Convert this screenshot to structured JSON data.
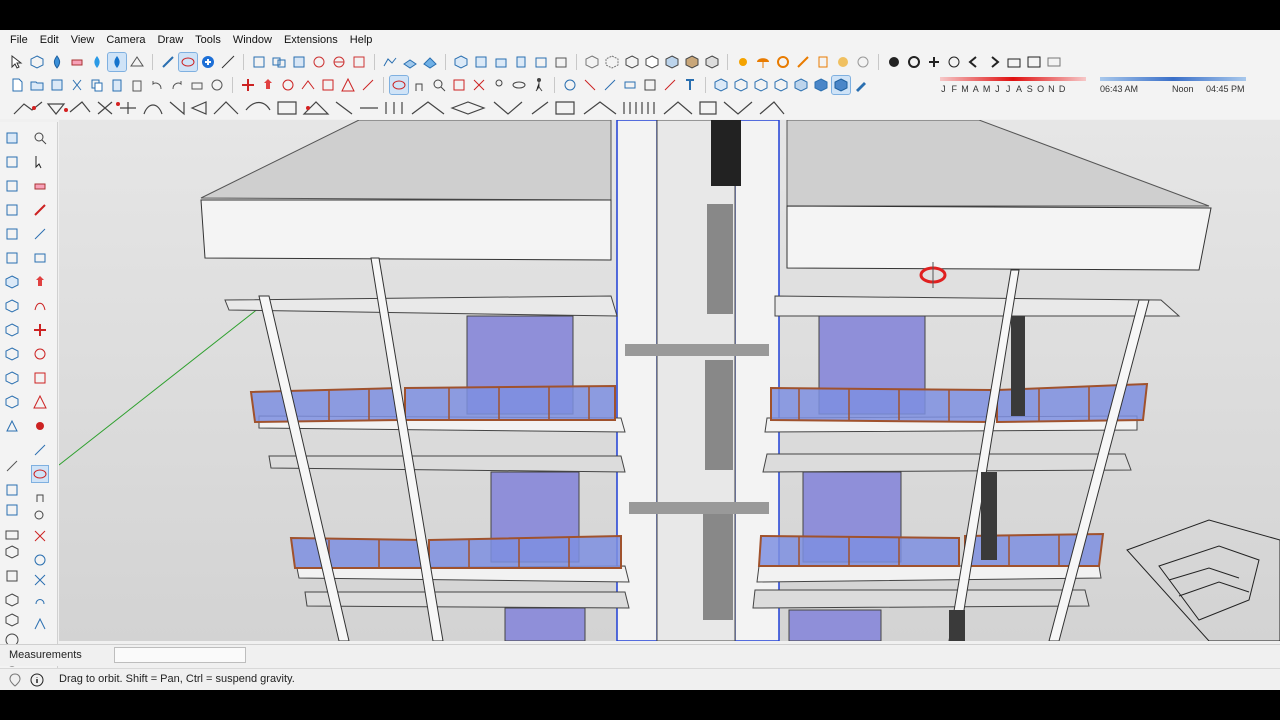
{
  "menu": {
    "items": [
      "File",
      "Edit",
      "View",
      "Camera",
      "Draw",
      "Tools",
      "Window",
      "Extensions",
      "Help"
    ]
  },
  "shadows": {
    "months": [
      "J",
      "F",
      "M",
      "A",
      "M",
      "J",
      "J",
      "A",
      "S",
      "O",
      "N",
      "D"
    ],
    "time_start": "06:43 AM",
    "time_mid": "Noon",
    "time_end": "04:45 PM"
  },
  "measurements": {
    "label": "Measurements",
    "value": ""
  },
  "status": {
    "hint": "Drag to orbit. Shift = Pan, Ctrl = suspend gravity."
  },
  "colors": {
    "glass": "#8f8fd9",
    "railing": "#a0522d",
    "axis_green": "#2ea02e",
    "selection_blue": "#1f3fd6",
    "orbit_cursor": "#e02020"
  },
  "icons": {
    "active_tool": "orbit-icon"
  }
}
